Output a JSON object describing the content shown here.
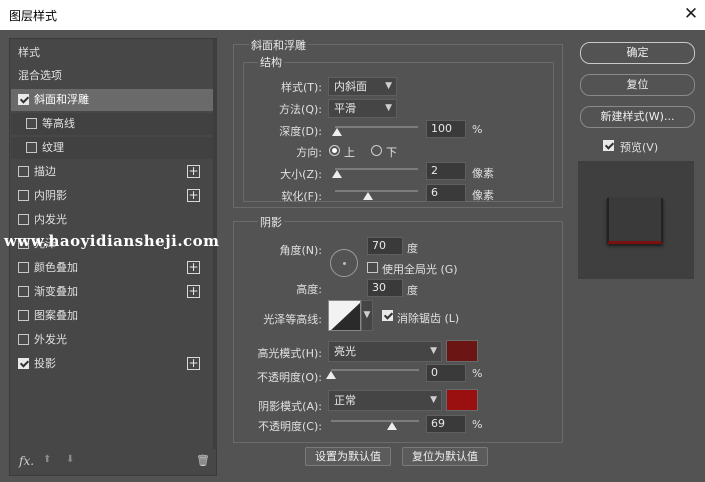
{
  "window": {
    "title": "图层样式",
    "close_glyph": "✕"
  },
  "sidebar": {
    "header": "样式",
    "blend_options": "混合选项",
    "items": [
      {
        "label": "斜面和浮雕",
        "checked": true,
        "selected": true,
        "plus": false
      },
      {
        "label": "等高线",
        "checked": false,
        "sub": true
      },
      {
        "label": "纹理",
        "checked": false,
        "sub": true
      },
      {
        "label": "描边",
        "checked": false,
        "plus": true
      },
      {
        "label": "内阴影",
        "checked": false,
        "plus": true
      },
      {
        "label": "内发光",
        "checked": false,
        "plus": false
      },
      {
        "label": "光泽",
        "checked": false,
        "plus": false
      },
      {
        "label": "颜色叠加",
        "checked": false,
        "plus": true
      },
      {
        "label": "渐变叠加",
        "checked": false,
        "plus": true
      },
      {
        "label": "图案叠加",
        "checked": false,
        "plus": false
      },
      {
        "label": "外发光",
        "checked": false,
        "plus": false
      },
      {
        "label": "投影",
        "checked": true,
        "plus": true
      }
    ],
    "plus_glyph": "+",
    "tools": {
      "fx": "fx.",
      "up": "⬆",
      "down": "⬇",
      "trash": "🗑"
    }
  },
  "bevel": {
    "group_title": "斜面和浮雕",
    "structure_title": "结构",
    "style_label": "样式(T):",
    "style_value": "内斜面",
    "method_label": "方法(Q):",
    "method_value": "平滑",
    "depth_label": "深度(D):",
    "depth_value": "100",
    "depth_unit": "%",
    "depth_fraction": 0.02,
    "direction_label": "方向:",
    "direction_up": "上",
    "direction_down": "下",
    "size_label": "大小(Z):",
    "size_value": "2",
    "size_unit": "像素",
    "size_fraction": 0.02,
    "soften_label": "软化(F):",
    "soften_value": "6",
    "soften_unit": "像素",
    "soften_fraction": 0.4
  },
  "shading": {
    "title": "阴影",
    "angle_label": "角度(N):",
    "angle_value": "70",
    "angle_unit": "度",
    "global_light_label": "使用全局光 (G)",
    "altitude_label": "高度:",
    "altitude_value": "30",
    "altitude_unit": "度",
    "gloss_label": "光泽等高线:",
    "antialias_label": "消除锯齿 (L)",
    "antialias_checked": true,
    "highlight_mode_label": "高光模式(H):",
    "highlight_mode_value": "亮光",
    "highlight_color": "#6b1515",
    "highlight_opacity_label": "不透明度(O):",
    "highlight_opacity_value": "0",
    "highlight_opacity_unit": "%",
    "highlight_opacity_fraction": 0.0,
    "shadow_mode_label": "阴影模式(A):",
    "shadow_mode_value": "正常",
    "shadow_color": "#9a0f0f",
    "shadow_opacity_label": "不透明度(C):",
    "shadow_opacity_value": "69",
    "shadow_opacity_unit": "%",
    "shadow_opacity_fraction": 0.69
  },
  "footer": {
    "set_default": "设置为默认值",
    "reset_default": "复位为默认值"
  },
  "actions": {
    "ok": "确定",
    "reset": "复位",
    "new_style": "新建样式(W)...",
    "preview_label": "预览(V)",
    "preview_checked": true
  },
  "watermark": "www.haoyidiansheji.com"
}
